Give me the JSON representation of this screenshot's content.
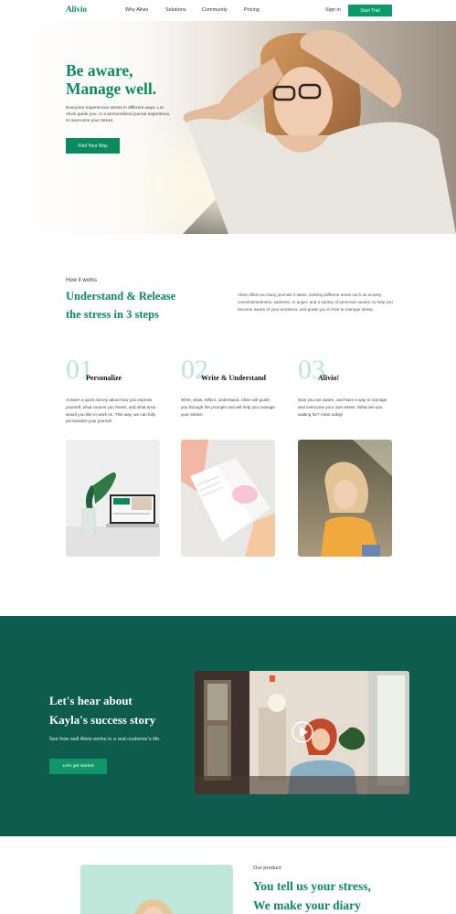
{
  "nav": {
    "logo": "Alivio",
    "links": [
      "Why Alivio",
      "Solutions",
      "Community",
      "Pricing"
    ],
    "signin": "Sign in",
    "cta": "Start Trial"
  },
  "hero": {
    "title_line1": "Be aware,",
    "title_line2": "Manage well.",
    "description": "Everyone experiences stress in different ways. Let Alivio guide you, in a personalized journal experience, to overcome your stress.",
    "button": "Find Your Way"
  },
  "how": {
    "label": "How it works",
    "title_line1": "Understand & Release",
    "title_line2": "the stress in 3 steps",
    "description": "Alivio offers as many journals it takes, tackling different areas such as anxiety, overwhelmedness, sadness, or anger, and a variety of personal causes, to help you become aware of your emotions, and guide you in how to manage stress.",
    "steps": [
      {
        "num": "01",
        "title": "Personalize",
        "desc_main": "Answer a quick survey about how you express yourself, what causes you stress, and what area would you like to work on. This way, we can fully ",
        "desc_em": "personalize",
        "desc_end": " your journal!"
      },
      {
        "num": "02",
        "title": "Write & Understand",
        "desc": "Write, draw, reflect, understand. Alivio will guide you through the prompts and will help you manage your stress!"
      },
      {
        "num": "03",
        "title": "Alivio!",
        "desc": "Now you are aware, and have a way to manage and overcome your own stress. What are you waiting for? Alivio today!"
      }
    ]
  },
  "story": {
    "title_line1": "Let's hear about",
    "title_line2": "Kayla's success story",
    "description": "See how well Alivio works in a real customer's life.",
    "button": "Let's get started"
  },
  "product": {
    "label": "Our product",
    "title_line1": "You tell us your stress,",
    "title_line2": "We make your diary"
  },
  "colors": {
    "brand": "#0b8a5f",
    "dark_green": "#0d5c4d",
    "mint": "#b9e6da"
  }
}
